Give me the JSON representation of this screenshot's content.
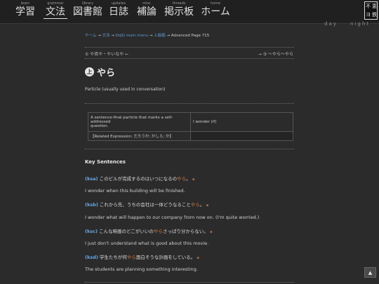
{
  "nav": {
    "items": [
      {
        "sub": "learn",
        "label": "学習"
      },
      {
        "sub": "grammar",
        "label": "文法"
      },
      {
        "sub": "library",
        "label": "図書館"
      },
      {
        "sub": "updates",
        "label": "日誌"
      },
      {
        "sub": "misc",
        "label": "補論"
      },
      {
        "sub": "threads",
        "label": "掲示板"
      },
      {
        "sub": "home",
        "label": "ホーム"
      }
    ],
    "logo": [
      "不",
      "恵",
      "ヨ",
      "鉄"
    ]
  },
  "theme": {
    "day": "day",
    "night": "night"
  },
  "breadcrumb": {
    "home": "ホーム",
    "grammar": "文法",
    "menu": "DoJG main menu",
    "level": "上級編",
    "current": "Advanced Page 715",
    "sep": "→"
  },
  "pager": {
    "prev": "① や否や・やいなや ←",
    "next": "→ ③ 〜やら〜やら"
  },
  "entry": {
    "level_mark": "上",
    "title": "やら",
    "description": "Particle (usually used in conversation)"
  },
  "definition": {
    "meaning_lines": [
      "A sentence-final particle that marks a self-addressed",
      "question."
    ],
    "english": "I wonder (if)",
    "related": "【Related Expression: だろうか; かしら; か】"
  },
  "key_sentences": {
    "heading": "Key Sentences",
    "items": [
      {
        "label": "(ksa)",
        "pre": "このビルが完成するのはいつになるの",
        "hl": "やら",
        "post": "。",
        "english": "I wonder when this building will be finished."
      },
      {
        "label": "(ksb)",
        "pre": "これから先、うちの会社は一体どうなること",
        "hl": "やら",
        "post": "。",
        "english": "I wonder what will happen to our company from now on. (I'm quite worried.)"
      },
      {
        "label": "(ksc)",
        "pre": "こんな映画のどこがいいの",
        "hl": "やら",
        "post": "さっぱり分からない。",
        "english": "I just don't understand what is good about this movie."
      },
      {
        "label": "(ksd)",
        "pre": "学生たちが何",
        "hl": "やら",
        "post": "面白そうな計画をしている。",
        "english": "The students are planning something interesting."
      }
    ]
  },
  "to_top": "▲"
}
